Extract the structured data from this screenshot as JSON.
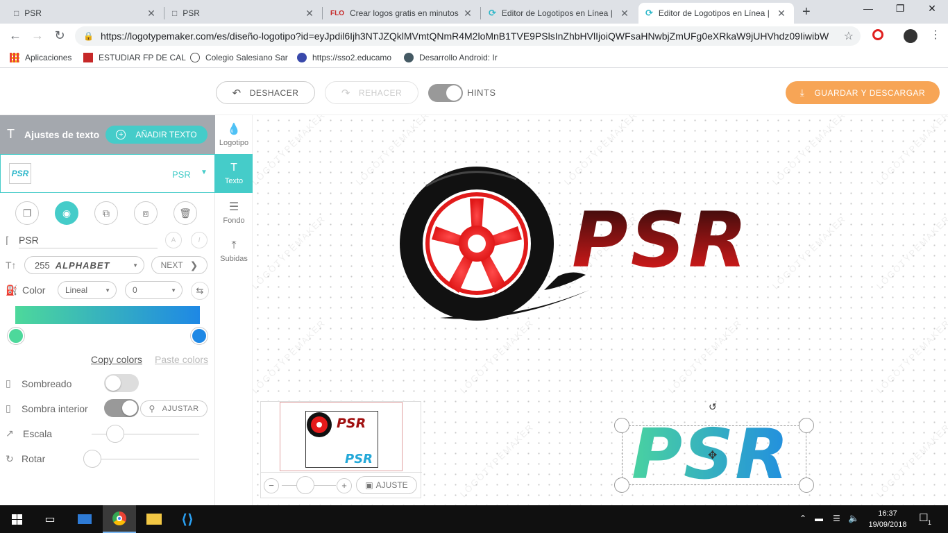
{
  "browser": {
    "tabs": [
      {
        "title": "PSR",
        "active": false
      },
      {
        "title": "PSR",
        "active": false
      },
      {
        "title": "Crear logos gratis en minutos",
        "active": false
      },
      {
        "title": "Editor de Logotipos en Línea |",
        "active": false
      },
      {
        "title": "Editor de Logotipos en Línea |",
        "active": true
      }
    ],
    "new_tab_glyph": "+",
    "url": "https://logotypemaker.com/es/diseño-logotipo?id=eyJpdil6Ijh3NTJZQklMVmtQNmR4M2loMnB1TVE9PSlsInZhbHVlIjoiQWFsaHNwbjZmUFg0eXRkaW9jUHVhdz09IiwibWF...",
    "bookmarks": [
      {
        "label": "Aplicaciones"
      },
      {
        "label": "ESTUDIAR FP DE CAL"
      },
      {
        "label": "Colegio Salesiano Sar"
      },
      {
        "label": "https://sso2.educamo"
      },
      {
        "label": "Desarrollo Android: Ir"
      }
    ]
  },
  "toolbar": {
    "undo_label": "DESHACER",
    "redo_label": "REHACER",
    "hints_label": "HINTS",
    "save_label": "GUARDAR Y DESCARGAR"
  },
  "panel": {
    "title": "Ajustes de texto",
    "add_text_label": "AÑADIR TEXTO",
    "layer_name": "PSR",
    "text_value": "PSR",
    "font_size": "255",
    "font_name": "ALPHABET",
    "next_label": "NEXT",
    "color_label": "Color",
    "gradient_type": "Lineal",
    "gradient_angle": "0",
    "copy_colors": "Copy colors",
    "paste_colors": "Paste colors",
    "shadow_label": "Sombreado",
    "inner_shadow_label": "Sombra interior",
    "adjust_label": "AJUSTAR",
    "scale_label": "Escala",
    "rotate_label": "Rotar",
    "gradient_start": "#4dd89b",
    "gradient_end": "#1e88e5",
    "scale_level": 0.22,
    "rotate_level": 0
  },
  "vnav": [
    {
      "label": "Logotipo",
      "icon": "drop-icon"
    },
    {
      "label": "Texto",
      "icon": "text-icon"
    },
    {
      "label": "Fondo",
      "icon": "sliders-icon"
    },
    {
      "label": "Subidas",
      "icon": "upload-icon"
    }
  ],
  "canvas": {
    "logo_text": "PSR",
    "selected_text": "PSR",
    "watermark": "LOGOTYPEMAKER"
  },
  "preview": {
    "logo_text": "PSR",
    "teal_text": "PSR",
    "fit_label": "AJUSTE"
  },
  "taskbar": {
    "time": "16:37",
    "date": "19/09/2018",
    "notification_count": "1"
  },
  "colors": {
    "accent": "#45ccc9",
    "save": "#f7a556",
    "logo_red": "#e51b1b"
  }
}
